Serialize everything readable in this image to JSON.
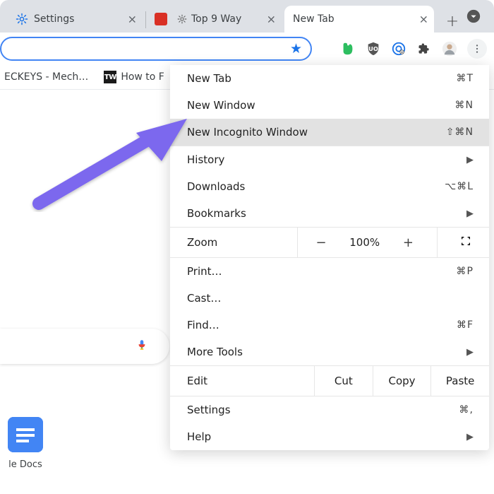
{
  "tabs": [
    {
      "label": "Settings"
    },
    {
      "label": "Top 9 Way"
    },
    {
      "label": "New Tab"
    }
  ],
  "bookmarks": [
    {
      "label": "ECKEYS - Mech…"
    },
    {
      "label": "How to F"
    }
  ],
  "ntp": {
    "shortcut_label": "le Docs"
  },
  "menu": {
    "new_tab": {
      "label": "New Tab",
      "shortcut": "⌘T"
    },
    "new_window": {
      "label": "New Window",
      "shortcut": "⌘N"
    },
    "incognito": {
      "label": "New Incognito Window",
      "shortcut": "⇧⌘N"
    },
    "history": {
      "label": "History"
    },
    "downloads": {
      "label": "Downloads",
      "shortcut": "⌥⌘L"
    },
    "bookmarks": {
      "label": "Bookmarks"
    },
    "zoom": {
      "label": "Zoom",
      "value": "100%"
    },
    "print": {
      "label": "Print…",
      "shortcut": "⌘P"
    },
    "cast": {
      "label": "Cast…"
    },
    "find": {
      "label": "Find…",
      "shortcut": "⌘F"
    },
    "more_tools": {
      "label": "More Tools"
    },
    "edit": {
      "label": "Edit",
      "cut": "Cut",
      "copy": "Copy",
      "paste": "Paste"
    },
    "settings": {
      "label": "Settings",
      "shortcut": "⌘,"
    },
    "help": {
      "label": "Help"
    }
  }
}
